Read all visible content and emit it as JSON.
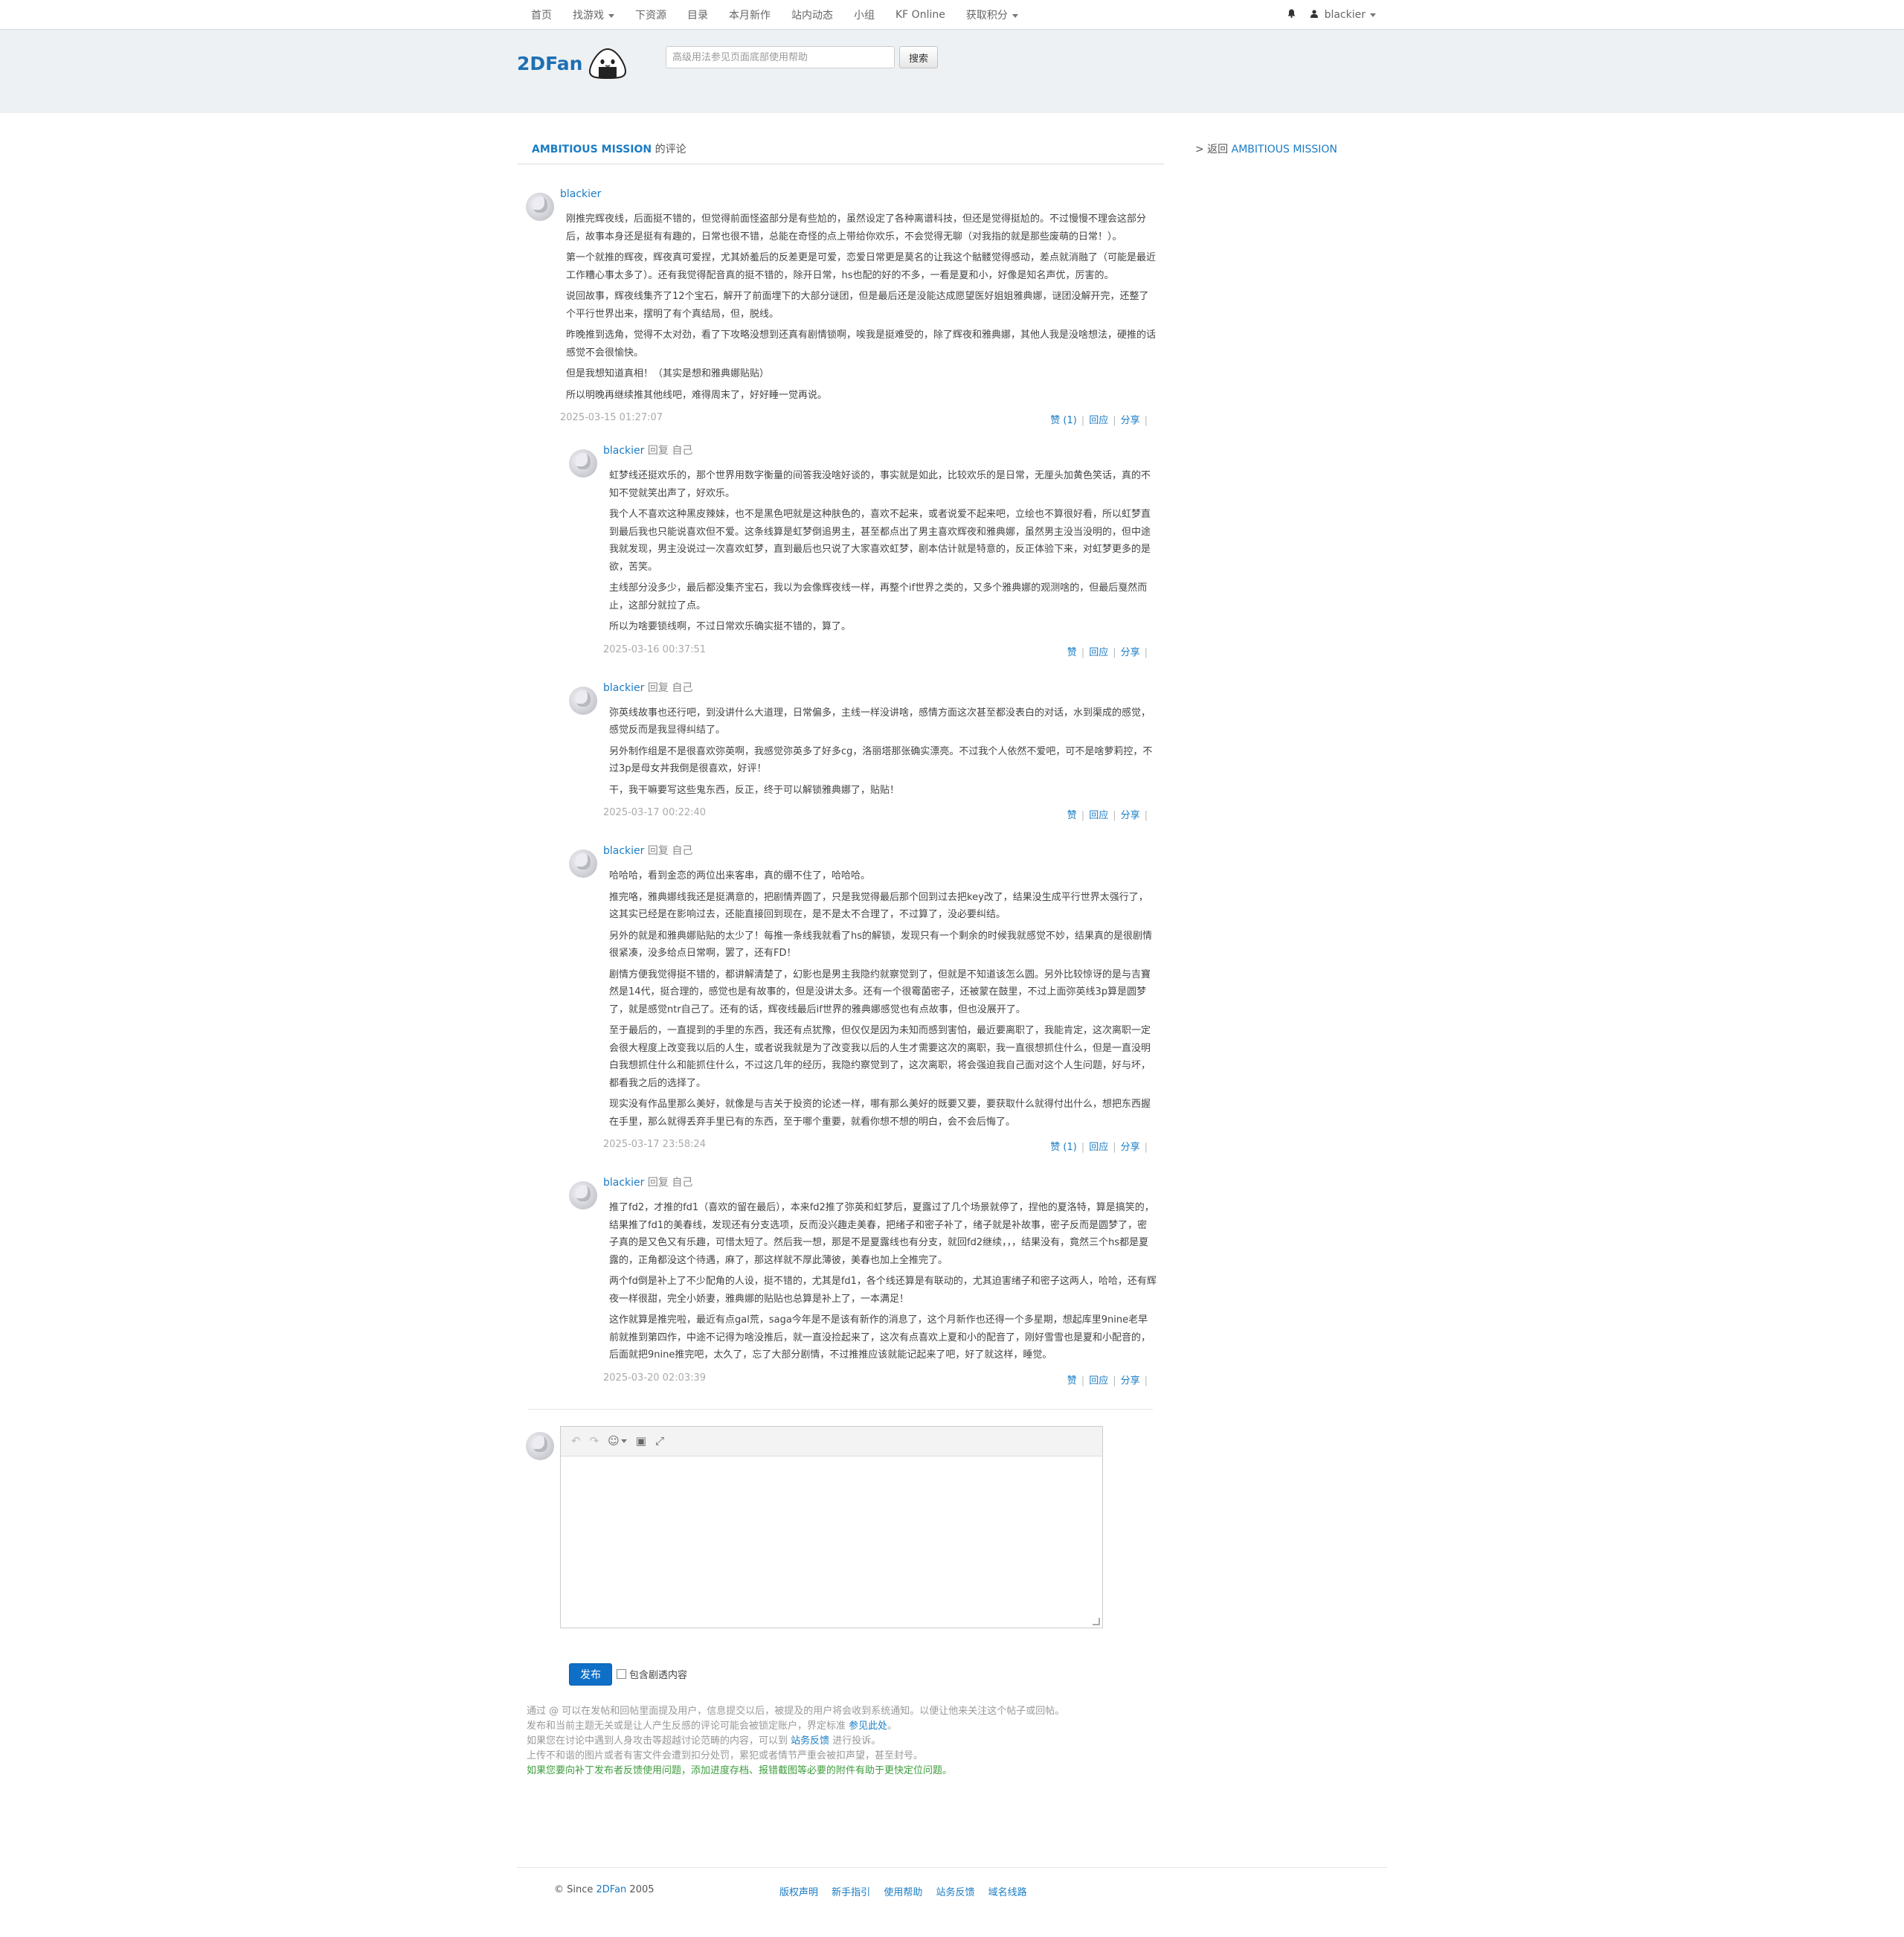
{
  "nav": {
    "items": [
      {
        "label": "首页",
        "dropdown": false
      },
      {
        "label": "找游戏",
        "dropdown": true
      },
      {
        "label": "下资源",
        "dropdown": false
      },
      {
        "label": "目录",
        "dropdown": false
      },
      {
        "label": "本月新作",
        "dropdown": false
      },
      {
        "label": "站内动态",
        "dropdown": false
      },
      {
        "label": "小组",
        "dropdown": false
      },
      {
        "label": "KF Online",
        "dropdown": false
      },
      {
        "label": "获取积分",
        "dropdown": true
      }
    ],
    "bell_icon": "bell-icon",
    "user_label": "blackier"
  },
  "header": {
    "logo_text": "2DFan",
    "search_placeholder": "高级用法参见页面底部使用帮助",
    "search_button": "搜索"
  },
  "page": {
    "title_game": "AMBITIOUS MISSION",
    "title_suffix": " 的评论",
    "back_prefix": "> 返回 ",
    "back_link": "AMBITIOUS MISSION"
  },
  "main_comment": {
    "author": "blackier",
    "paragraphs": [
      "刚推完辉夜线，后面挺不错的，但觉得前面怪盗部分是有些尬的，虽然设定了各种离谱科技，但还是觉得挺尬的。不过慢慢不理会这部分后，故事本身还是挺有有趣的，日常也很不错，总能在奇怪的点上带给你欢乐，不会觉得无聊（对我指的就是那些废萌的日常！）。",
      "第一个就推的辉夜，辉夜真可爱捏，尤其娇羞后的反差更是可爱，恋爱日常更是莫名的让我这个骷髅觉得感动，差点就消融了（可能是最近工作糟心事太多了）。还有我觉得配音真的挺不错的，除开日常，hs也配的好的不多，一看是夏和小，好像是知名声优，厉害的。",
      "说回故事，辉夜线集齐了12个宝石，解开了前面埋下的大部分谜团，但是最后还是没能达成愿望医好姐姐雅典娜，谜团没解开完，还整了个平行世界出来，摆明了有个真结局，但，脱线。",
      "昨晚推到选角，觉得不太对劲，看了下攻略没想到还真有剧情锁啊，唉我是挺难受的，除了辉夜和雅典娜，其他人我是没啥想法，硬推的话感觉不会很愉快。",
      "但是我想知道真相！（其实是想和雅典娜贴贴）",
      "所以明晚再继续推其他线吧，难得周末了，好好睡一觉再说。"
    ],
    "time": "2025-03-15 01:27:07",
    "like": "赞 (1)",
    "reply": "回应",
    "share": "分享"
  },
  "replies": [
    {
      "author": "blackier",
      "reply_text": "回复 自己",
      "paragraphs": [
        "虹梦线还挺欢乐的，那个世界用数字衡量的间答我没啥好谈的，事实就是如此，比较欢乐的是日常，无厘头加黄色笑话，真的不知不觉就笑出声了，好欢乐。",
        "我个人不喜欢这种黑皮辣妹，也不是黑色吧就是这种肤色的，喜欢不起来，或者说爱不起来吧，立绘也不算很好看，所以虹梦直到最后我也只能说喜欢但不爱。这条线算是虹梦倒追男主，甚至都点出了男主喜欢辉夜和雅典娜，虽然男主没当没明的，但中途我就发现，男主没说过一次喜欢虹梦，直到最后也只说了大家喜欢虹梦，剧本估计就是特意的，反正体验下来，对虹梦更多的是欲，苦笑。",
        "主线部分没多少，最后都没集齐宝石，我以为会像辉夜线一样，再整个if世界之类的，又多个雅典娜的观测啥的，但最后戛然而止，这部分就拉了点。",
        "所以为啥要锁线啊，不过日常欢乐确实挺不错的，算了。"
      ],
      "time": "2025-03-16 00:37:51",
      "like": "赞",
      "reply": "回应",
      "share": "分享"
    },
    {
      "author": "blackier",
      "reply_text": "回复 自己",
      "paragraphs": [
        "弥英线故事也还行吧，到没讲什么大道理，日常偏多，主线一样没讲啥，感情方面这次甚至都没表白的对话，水到渠成的感觉，感觉反而是我显得纠结了。",
        "另外制作组是不是很喜欢弥英啊，我感觉弥英多了好多cg，洛丽塔那张确实漂亮。不过我个人依然不爱吧，可不是啥萝莉控，不过3p是母女丼我倒是很喜欢，好评！",
        "干，我干嘛要写这些鬼东西，反正，终于可以解锁雅典娜了，贴贴！"
      ],
      "time": "2025-03-17 00:22:40",
      "like": "赞",
      "reply": "回应",
      "share": "分享"
    },
    {
      "author": "blackier",
      "reply_text": "回复 自己",
      "paragraphs": [
        "哈哈哈，看到金恋的两位出来客串，真的绷不住了，哈哈哈。",
        "推完咯，雅典娜线我还是挺满意的，把剧情弄圆了，只是我觉得最后那个回到过去把key改了，结果没生成平行世界太强行了，这其实已经是在影响过去，还能直接回到现在，是不是太不合理了，不过算了，没必要纠结。",
        "另外的就是和雅典娜贴贴的太少了！每推一条线我就看了hs的解锁，发现只有一个剩余的时候我就感觉不妙，结果真的是很剧情很紧凑，没多给点日常啊，罢了，还有FD！",
        "剧情方便我觉得挺不错的，都讲解清楚了，幻影也是男主我隐约就察觉到了，但就是不知道该怎么圆。另外比较惊讶的是与吉寶然是14代，挺合理的，感觉也是有故事的，但是没讲太多。还有一个很霉菌密子，还被蒙在鼓里，不过上面弥英线3p算是圆梦了，就是感觉ntr自己了。还有的话，辉夜线最后if世界的雅典娜感觉也有点故事，但也没展开了。",
        "至于最后的，一直提到的手里的东西，我还有点犹豫，但仅仅是因为未知而感到害怕，最近要离职了，我能肯定，这次离职一定会很大程度上改变我以后的人生，或者说我就是为了改变我以后的人生才需要这次的离职，我一直很想抓住什么，但是一直没明白我想抓住什么和能抓住什么，不过这几年的经历，我隐约察觉到了，这次离职，将会强迫我自己面对这个人生问题，好与坏，都看我之后的选择了。",
        "现实没有作品里那么美好，就像是与吉关于投资的论述一样，哪有那么美好的既要又要，要获取什么就得付出什么，想把东西握在手里，那么就得丢弃手里已有的东西，至于哪个重要，就看你想不想的明白，会不会后悔了。"
      ],
      "time": "2025-03-17 23:58:24",
      "like": "赞 (1)",
      "reply": "回应",
      "share": "分享"
    },
    {
      "author": "blackier",
      "reply_text": "回复 自己",
      "paragraphs": [
        "推了fd2，才推的fd1（喜欢的留在最后），本来fd2推了弥英和虹梦后，夏露过了几个场景就停了，捏他的夏洛特，算是搞笑的，结果推了fd1的美春线，发现还有分支选项，反而没兴趣走美春，把绪子和密子补了，绪子就是补故事，密子反而是圆梦了，密子真的是又色又有乐趣，可惜太短了。然后我一想，那是不是夏露线也有分支，就回fd2继续，，，结果没有，竟然三个hs都是夏露的，正角都没这个待遇，麻了，那这样就不厚此薄彼，美春也加上全推完了。",
        "两个fd倒是补上了不少配角的人设，挺不错的，尤其是fd1，各个线还算是有联动的，尤其迫害绪子和密子这两人，哈哈，还有辉夜一样很甜，完全小娇妻，雅典娜的贴贴也总算是补上了，一本满足！",
        "这作就算是推完啦，最近有点gal荒，saga今年是不是该有新作的消息了，这个月新作也还得一个多星期，想起库里9nine老早前就推到第四作，中途不记得为啥没推后，就一直没捡起来了，这次有点喜欢上夏和小的配音了，刚好雪雪也是夏和小配音的，后面就把9nine推完吧，太久了，忘了大部分剧情，不过推推应该就能记起来了吧，好了就这样，睡觉。"
      ],
      "time": "2025-03-20 02:03:39",
      "like": "赞",
      "reply": "回应",
      "share": "分享"
    }
  ],
  "editor": {
    "undo_icon": "undo-icon",
    "redo_icon": "redo-icon",
    "emoji_icon": "emoji-icon",
    "image_icon": "image-icon",
    "fullscreen_icon": "fullscreen-icon",
    "submit_label": "发布",
    "spoiler_label": "包含剧透内容"
  },
  "notes": {
    "line1": "通过 @ 可以在发帖和回帖里面提及用户，信息提交以后，被提及的用户将会收到系统通知。以便让他来关注这个帖子或回帖。",
    "line2_pre": "发布和当前主题无关或是让人产生反感的评论可能会被锁定账户，界定标准 ",
    "line2_link": "参见此处",
    "line2_post": "。",
    "line3_pre": "如果您在讨论中遇到人身攻击等超越讨论范畴的内容，可以到 ",
    "line3_link": "站务反馈",
    "line3_post": " 进行投诉。",
    "line4": "上传不和谐的图片或者有害文件会遭到扣分处罚，累犯或者情节严重会被扣声望，甚至封号。",
    "line5": "如果您要向补丁发布者反馈使用问题，添加进度存档、报错截图等必要的附件有助于更快定位问题。"
  },
  "footer": {
    "since_pre": "© Since ",
    "since_link": "2DFan",
    "since_post": " 2005",
    "links": [
      "版权声明",
      "新手指引",
      "使用帮助",
      "站务反馈",
      "域名线路"
    ]
  },
  "colors": {
    "link": "#1a7cc4",
    "logo": "#1f6fb2",
    "header_bg": "#eef1f4",
    "submit_bg": "#0e6fc7",
    "note_green": "#3c9d3c"
  }
}
